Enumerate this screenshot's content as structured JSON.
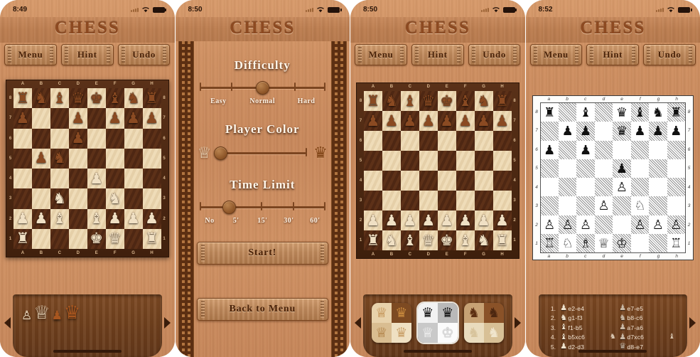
{
  "app": {
    "title": "CHESS"
  },
  "screens": [
    {
      "id": "game-3d",
      "status": {
        "time": "8:49",
        "wifi": "wifi-icon",
        "battery": "battery-icon"
      },
      "toolbar": {
        "menu": "Menu",
        "hint": "Hint",
        "undo": "Undo"
      },
      "board": {
        "style": "3d-wood",
        "files": [
          "A",
          "B",
          "C",
          "D",
          "E",
          "F",
          "G",
          "H"
        ],
        "ranks": [
          "8",
          "7",
          "6",
          "5",
          "4",
          "3",
          "2",
          "1"
        ],
        "position": [
          [
            "r",
            "n",
            "b",
            "q",
            "k",
            "b",
            "n",
            "r"
          ],
          [
            "p",
            "",
            "",
            "p",
            "",
            "p",
            "p",
            "p"
          ],
          [
            "",
            "",
            "",
            "p",
            "",
            "",
            "",
            ""
          ],
          [
            "",
            "p",
            "n",
            "",
            "",
            "",
            "",
            ""
          ],
          [
            "",
            "",
            "",
            "",
            "P",
            "",
            "",
            ""
          ],
          [
            "",
            "",
            "N",
            "",
            "",
            "N",
            "",
            ""
          ],
          [
            "P",
            "P",
            "B",
            "",
            "B",
            "P",
            "P",
            "P"
          ],
          [
            "R",
            "",
            "",
            "",
            "K",
            "Q",
            "",
            "R"
          ]
        ]
      },
      "tray": {
        "captured": [
          "white-pawn",
          "white-queen",
          "brown-pawn",
          "brown-queen"
        ],
        "prev": "prev-arrow",
        "next": "next-arrow"
      }
    },
    {
      "id": "settings",
      "status": {
        "time": "8:50",
        "wifi": "wifi-icon",
        "battery": "battery-icon"
      },
      "difficulty": {
        "title": "Difficulty",
        "labels": [
          "Easy",
          "Normal",
          "Hard"
        ],
        "ticks": 5,
        "value": "Normal",
        "knob_pct": 50
      },
      "player_color": {
        "title": "Player Color",
        "left_icon": "white-queen-icon",
        "right_icon": "black-queen-icon",
        "value": "white",
        "knob_pct": 5
      },
      "time_limit": {
        "title": "Time Limit",
        "labels": [
          "No",
          "5'",
          "15'",
          "30'",
          "60'"
        ],
        "value": "5'",
        "knob_pct": 25
      },
      "buttons": {
        "start": "Start!",
        "back": "Back to Menu"
      }
    },
    {
      "id": "game-2d-wood",
      "status": {
        "time": "8:50",
        "wifi": "wifi-icon",
        "battery": "battery-icon"
      },
      "toolbar": {
        "menu": "Menu",
        "hint": "Hint",
        "undo": "Undo"
      },
      "board": {
        "style": "2d-wood",
        "files": [
          "A",
          "B",
          "C",
          "D",
          "E",
          "F",
          "G",
          "H"
        ],
        "ranks": [
          "8",
          "7",
          "6",
          "5",
          "4",
          "3",
          "2",
          "1"
        ],
        "position": [
          [
            "r",
            "n",
            "b",
            "q",
            "k",
            "b",
            "n",
            "r"
          ],
          [
            "p",
            "p",
            "p",
            "p",
            "p",
            "p",
            "p",
            "p"
          ],
          [
            "",
            "",
            "",
            "",
            "",
            "",
            "",
            ""
          ],
          [
            "",
            "",
            "",
            "",
            "",
            "",
            "",
            ""
          ],
          [
            "",
            "",
            "",
            "",
            "",
            "",
            "",
            ""
          ],
          [
            "",
            "",
            "",
            "",
            "",
            "",
            "",
            ""
          ],
          [
            "P",
            "P",
            "P",
            "P",
            "P",
            "P",
            "P",
            "P"
          ],
          [
            "R",
            "N",
            "B",
            "Q",
            "K",
            "B",
            "N",
            "R"
          ]
        ]
      },
      "themes": {
        "options": [
          "wood-classic",
          "high-contrast",
          "wood-modern"
        ],
        "selected": "high-contrast",
        "prev": "prev-arrow",
        "next": "next-arrow"
      }
    },
    {
      "id": "game-diagram",
      "status": {
        "time": "8:52",
        "wifi": "wifi-icon",
        "battery": "battery-icon"
      },
      "toolbar": {
        "menu": "Menu",
        "hint": "Hint",
        "undo": "Undo"
      },
      "board": {
        "style": "diagram",
        "files": [
          "a",
          "b",
          "c",
          "d",
          "e",
          "f",
          "g",
          "h"
        ],
        "ranks": [
          "8",
          "7",
          "6",
          "5",
          "4",
          "3",
          "2",
          "1"
        ],
        "position": [
          [
            "r",
            "",
            "b",
            "",
            "q",
            "b",
            "n",
            "r"
          ],
          [
            "",
            "p",
            "p",
            "",
            "q",
            "p",
            "p",
            "p"
          ],
          [
            "p",
            "",
            "p",
            "",
            "",
            "",
            "",
            ""
          ],
          [
            "",
            "",
            "",
            "",
            "p",
            "",
            "",
            ""
          ],
          [
            "",
            "",
            "",
            "",
            "P",
            "",
            "",
            ""
          ],
          [
            "",
            "",
            "",
            "P",
            "",
            "N",
            "",
            ""
          ],
          [
            "P",
            "P",
            "P",
            "",
            "",
            "P",
            "P",
            "P"
          ],
          [
            "R",
            "N",
            "B",
            "Q",
            "K",
            "",
            "",
            "R"
          ]
        ]
      },
      "moves": [
        {
          "no": "1.",
          "white_piece": "pawn",
          "white": "e2-e4",
          "black_piece": "pawn",
          "black": "e7-e5",
          "white_captured": "",
          "black_captured": ""
        },
        {
          "no": "2.",
          "white_piece": "knight",
          "white": "g1-f3",
          "black_piece": "knight",
          "black": "b8-c6",
          "white_captured": "",
          "black_captured": ""
        },
        {
          "no": "3.",
          "white_piece": "bishop",
          "white": "f1-b5",
          "black_piece": "pawn",
          "black": "a7-a6",
          "white_captured": "",
          "black_captured": ""
        },
        {
          "no": "4.",
          "white_piece": "bishop",
          "white": "b5xc6",
          "black_piece": "pawn",
          "black": "d7xc6",
          "white_captured": "knight",
          "black_captured": "bishop"
        },
        {
          "no": "5.",
          "white_piece": "pawn",
          "white": "d2-d3",
          "black_piece": "queen",
          "black": "d8-e7",
          "white_captured": "",
          "black_captured": ""
        }
      ],
      "nav": {
        "next": "next-arrow"
      }
    }
  ]
}
